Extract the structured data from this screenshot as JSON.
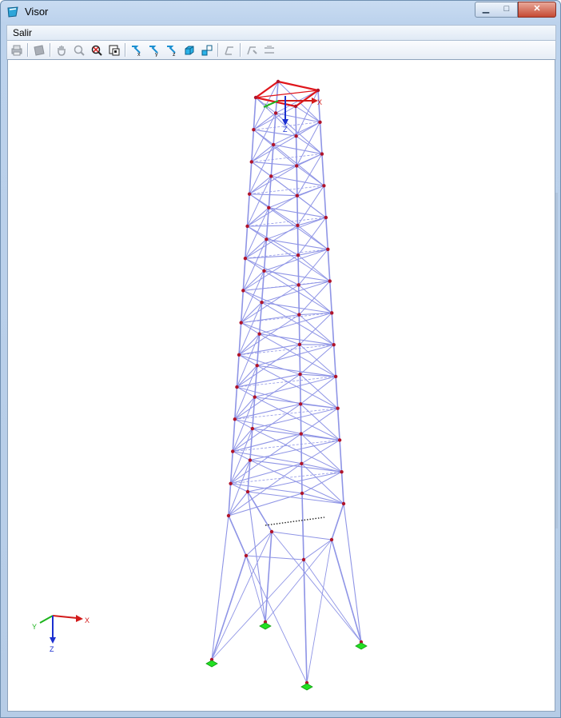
{
  "window": {
    "title": "Visor",
    "minimize_glyph": "▁",
    "maximize_glyph": "□",
    "close_glyph": "✕"
  },
  "menu": {
    "items": [
      {
        "label": "Salir"
      }
    ]
  },
  "toolbar": {
    "buttons": [
      {
        "icon": "print-icon",
        "enabled": false
      },
      {
        "icon": "export-icon",
        "enabled": false
      },
      {
        "icon": "pan-hand-icon",
        "enabled": false
      },
      {
        "icon": "zoom-icon",
        "enabled": false
      },
      {
        "icon": "zoom-all-icon",
        "enabled": true
      },
      {
        "icon": "zoom-window-icon",
        "enabled": true
      },
      {
        "icon": "view-x-icon",
        "enabled": true
      },
      {
        "icon": "view-y-icon",
        "enabled": true
      },
      {
        "icon": "view-z-icon",
        "enabled": true
      },
      {
        "icon": "iso-view-icon",
        "enabled": true
      },
      {
        "icon": "iso-view-2-icon",
        "enabled": true
      },
      {
        "icon": "display-members-icon",
        "enabled": false
      },
      {
        "icon": "display-settings-icon",
        "enabled": false
      },
      {
        "icon": "display-numbering-icon",
        "enabled": false
      }
    ]
  },
  "model_axes": {
    "x_label": "X",
    "y_label": "Y",
    "z_label": "Z"
  },
  "global_axes": {
    "x_label": "X",
    "y_label": "Y",
    "z_label": "Z"
  },
  "colors": {
    "member": "#8f95e6",
    "node": "#b0142a",
    "support": "#22e022",
    "top_frame": "#e0151b",
    "axis_x": "#d21b1b",
    "axis_y": "#1db41d",
    "axis_z": "#1b2fd0"
  }
}
